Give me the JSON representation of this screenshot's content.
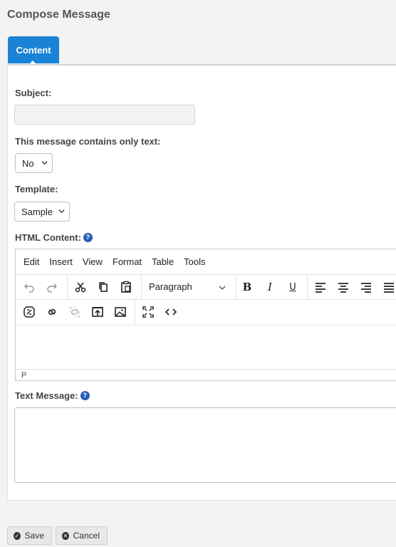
{
  "page": {
    "title": "Compose Message"
  },
  "tabs": [
    {
      "label": "Content",
      "active": true
    }
  ],
  "form": {
    "subject": {
      "label": "Subject:",
      "value": ""
    },
    "text_only": {
      "label": "This message contains only text:",
      "value": "No"
    },
    "template": {
      "label": "Template:",
      "value": "Sample"
    },
    "html_content": {
      "label": "HTML Content:",
      "help_icon": "question-circle-icon",
      "menu": [
        "Edit",
        "Insert",
        "View",
        "Format",
        "Table",
        "Tools"
      ],
      "block_format": "Paragraph",
      "toolbar_row1": [
        "undo-icon",
        "redo-icon",
        "cut-icon",
        "copy-icon",
        "paste-icon",
        "bold-icon",
        "italic-icon",
        "underline-icon",
        "align-left-icon",
        "align-center-icon",
        "align-right-icon",
        "align-justify-icon"
      ],
      "toolbar_row2": [
        "merge-tag-icon",
        "link-icon",
        "unlink-icon",
        "upload-icon",
        "image-icon",
        "fullscreen-icon",
        "code-icon"
      ],
      "status_path": "P",
      "value": ""
    },
    "text_message": {
      "label": "Text Message:",
      "help_icon": "question-circle-icon",
      "value": ""
    }
  },
  "actions": {
    "save_label": "Save",
    "cancel_label": "Cancel"
  },
  "colors": {
    "tab_active": "#1a83d6",
    "help_icon": "#2a5db8"
  }
}
